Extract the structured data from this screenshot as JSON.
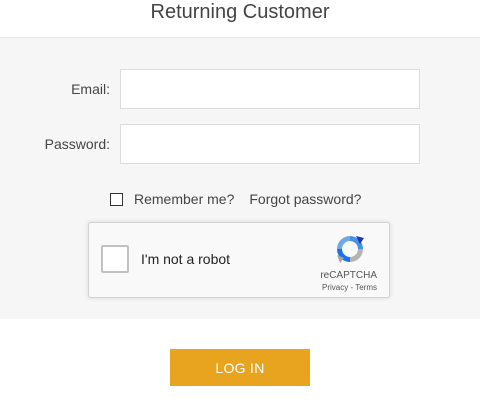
{
  "header": {
    "title": "Returning Customer"
  },
  "form": {
    "email_label": "Email:",
    "email_value": "",
    "password_label": "Password:",
    "password_value": "",
    "remember_label": "Remember me?",
    "remember_checked": false,
    "forgot_label": "Forgot password?"
  },
  "recaptcha": {
    "label": "I'm not a robot",
    "brand": "reCAPTCHA",
    "privacy": "Privacy",
    "separator": " - ",
    "terms": "Terms",
    "checked": false,
    "icon": "recaptcha-logo-icon"
  },
  "actions": {
    "login_label": "LOG IN"
  },
  "colors": {
    "accent": "#e8a41e",
    "panel_background": "#f6f6f6",
    "text": "#444444"
  }
}
